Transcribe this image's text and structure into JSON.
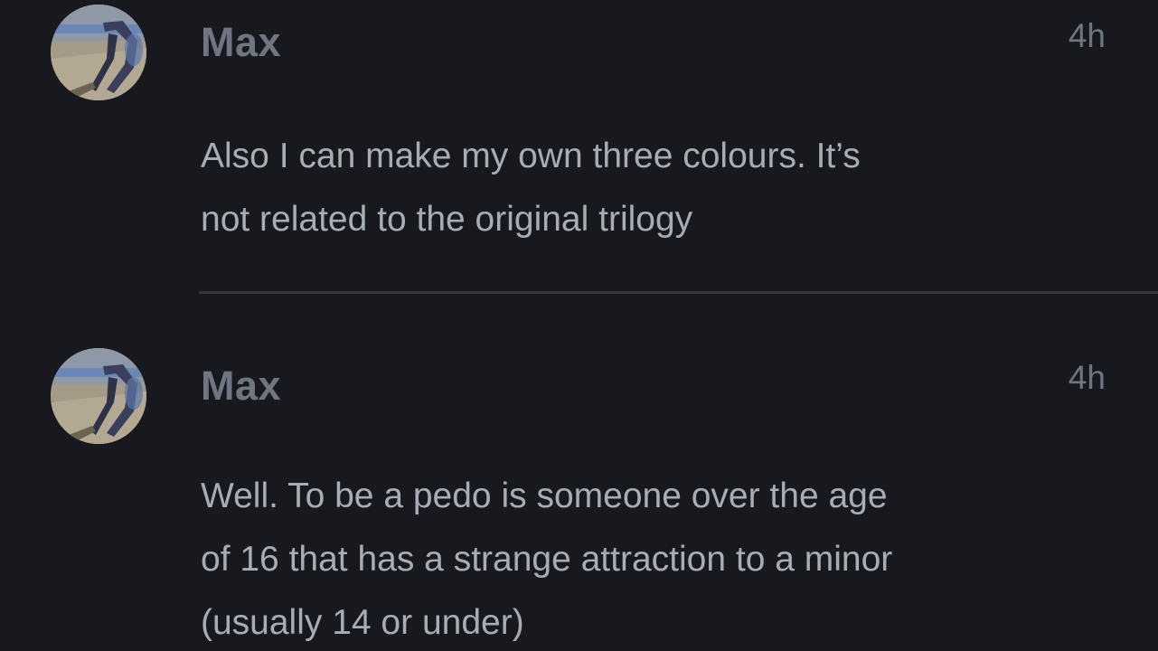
{
  "comments": [
    {
      "author": "Max",
      "time": "4h",
      "text_lines": [
        "Also I can make my own three colours. It’s",
        "not related to the original trilogy"
      ]
    },
    {
      "author": "Max",
      "time": "4h",
      "text_lines": [
        "Well. To be a pedo is someone over the age",
        "of 16 that has a strange attraction to a minor",
        "(usually 14 or under)"
      ]
    }
  ],
  "colors": {
    "background": "#17191e",
    "author": "#6f7681",
    "body_text": "#a8adb5",
    "divider": "#33363c"
  }
}
